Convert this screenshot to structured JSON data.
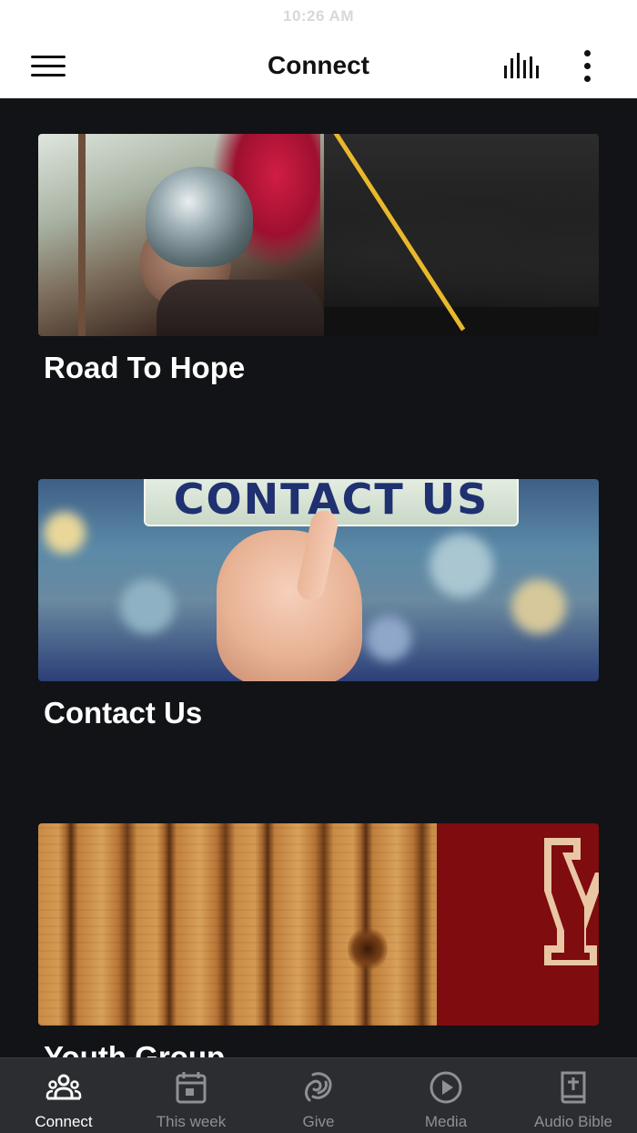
{
  "status_bar": {
    "time": "10:26 AM"
  },
  "header": {
    "title": "Connect"
  },
  "cards": [
    {
      "title": "Road To Hope"
    },
    {
      "title": "Contact Us",
      "image_text": "CONTACT US"
    },
    {
      "title": "Youth Group"
    }
  ],
  "tabs": [
    {
      "label": "Connect",
      "icon": "people-icon",
      "active": true
    },
    {
      "label": "This week",
      "icon": "calendar-icon",
      "active": false
    },
    {
      "label": "Give",
      "icon": "give-icon",
      "active": false
    },
    {
      "label": "Media",
      "icon": "play-circle-icon",
      "active": false
    },
    {
      "label": "Audio Bible",
      "icon": "bible-icon",
      "active": false
    }
  ],
  "colors": {
    "header_bg": "#ffffff",
    "content_bg": "#121316",
    "tabbar_bg": "#2b2d31",
    "tab_active": "#ffffff",
    "tab_inactive": "#8e9096"
  }
}
